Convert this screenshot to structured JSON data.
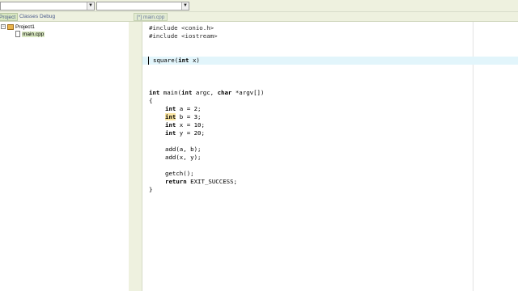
{
  "toolbar": {
    "combo_class_value": "",
    "combo_member_value": "",
    "combo_arrow": "▼"
  },
  "project_tabs": [
    "Project",
    "Classes",
    "Debug"
  ],
  "editor_tab": "[*] main.cpp",
  "tree": {
    "root_expander": "−",
    "root_label": "Project1",
    "file_label": "main.cpp"
  },
  "code": {
    "l1": "#include <conio.h>",
    "l2": "#include <iostream>",
    "l5_a": "square(",
    "l5_kw": "int",
    "l5_b": " x)",
    "l9_kw1": "int",
    "l9_a": " main(",
    "l9_kw2": "int",
    "l9_b": " argc, ",
    "l9_kw3": "char",
    "l9_c": " *argv[])",
    "l10": "{",
    "l12_kw": "int",
    "l12_rest": " a = 2;",
    "l13_kw": "int",
    "l13_rest": " b = 3;",
    "l14_kw": "int",
    "l14_rest": " x = 10;",
    "l15_kw": "int",
    "l15_rest": " y = 20;",
    "l17": "add(a, b);",
    "l18": "add(x, y);",
    "l20": "getch();",
    "l21_kw": "return",
    "l21_rest": " EXIT_SUCCESS;",
    "l22": "}"
  }
}
